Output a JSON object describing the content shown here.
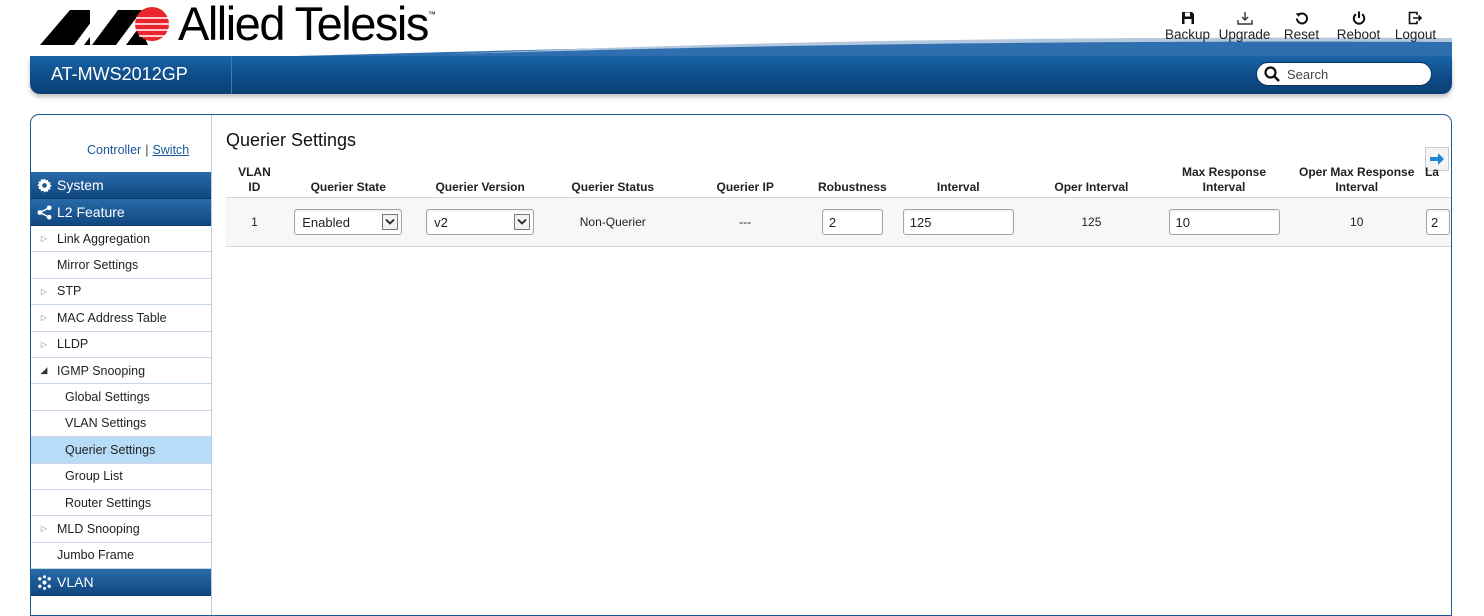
{
  "header": {
    "brand": "Allied Telesis",
    "trademark": "™",
    "model": "AT-MWS2012GP",
    "search_placeholder": "Search",
    "tools": [
      {
        "label": "Backup",
        "icon": "save-icon"
      },
      {
        "label": "Upgrade",
        "icon": "download-icon"
      },
      {
        "label": "Reset",
        "icon": "reset-icon"
      },
      {
        "label": "Reboot",
        "icon": "power-icon"
      },
      {
        "label": "Logout",
        "icon": "logout-icon"
      }
    ]
  },
  "context_switch": {
    "controller": "Controller",
    "separator": "|",
    "switch": "Switch"
  },
  "sidebar": {
    "system": "System",
    "l2_feature": "L2 Feature",
    "vlan": "VLAN",
    "items": [
      {
        "label": "Link Aggregation"
      },
      {
        "label": "Mirror Settings"
      },
      {
        "label": "STP"
      },
      {
        "label": "MAC Address Table"
      },
      {
        "label": "LLDP"
      },
      {
        "label": "IGMP Snooping"
      },
      {
        "label": "Global Settings"
      },
      {
        "label": "VLAN Settings"
      },
      {
        "label": "Querier Settings"
      },
      {
        "label": "Group List"
      },
      {
        "label": "Router Settings"
      },
      {
        "label": "MLD Snooping"
      },
      {
        "label": "Jumbo Frame"
      }
    ]
  },
  "page": {
    "title": "Querier Settings",
    "columns": {
      "vlan_id_1": "VLAN",
      "vlan_id_2": "ID",
      "querier_state": "Querier State",
      "querier_version": "Querier Version",
      "querier_status": "Querier Status",
      "querier_ip": "Querier IP",
      "robustness": "Robustness",
      "interval": "Interval",
      "oper_interval": "Oper Interval",
      "max_resp_1": "Max Response",
      "max_resp_2": "Interval",
      "oper_max_resp_1": "Oper Max Response",
      "oper_max_resp_2": "Interval",
      "last_partial": "La"
    },
    "row": {
      "vlan_id": "1",
      "querier_state": "Enabled",
      "querier_version": "v2",
      "querier_status": "Non-Querier",
      "querier_ip": "---",
      "robustness": "2",
      "interval": "125",
      "oper_interval": "125",
      "max_response_interval": "10",
      "oper_max_response_interval": "10",
      "last_partial": "2"
    }
  },
  "colors": {
    "nav_blue": "#0e4a86",
    "selected_row": "#b7dcf7",
    "logo_red": "#e8262b"
  }
}
